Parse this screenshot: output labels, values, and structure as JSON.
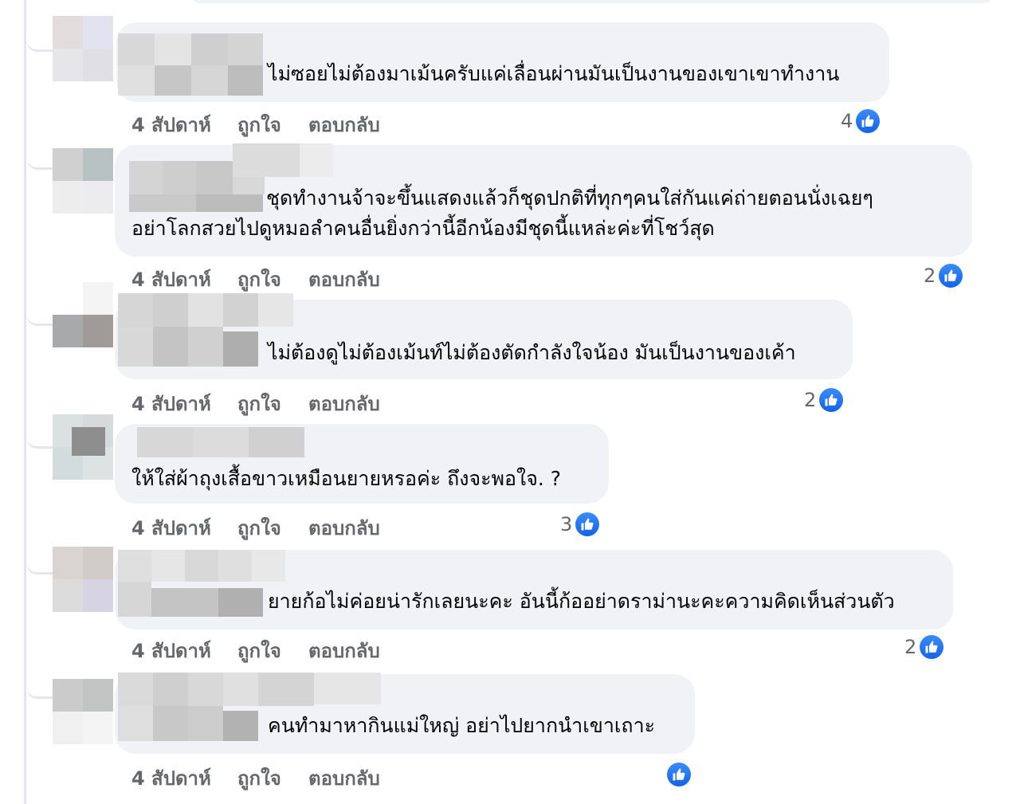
{
  "comments": [
    {
      "text_lines": [
        "ไม่ซอยไม่ต้องมาเม้นครับแค่เลื่อนผ่านมันเป็นงานของเขาเขาทำงาน"
      ],
      "time": "4 สัปดาห์",
      "like_label": "ถูกใจ",
      "reply_label": "ตอบกลับ",
      "reaction_count": "4"
    },
    {
      "text_lines": [
        "ชุดทำงานจ้าจะขึ้นแสดงแล้วก็ชุดปกติที่ทุกๆคนใส่กันแค่ถ่ายตอนนั่งเฉยๆ",
        "อย่าโลกสวยไปดูหมอลำคนอื่นยิ่งกว่านี้อีกน้องมีชุดนี้แหล่ะค่ะที่โชว์สุด"
      ],
      "time": "4 สัปดาห์",
      "like_label": "ถูกใจ",
      "reply_label": "ตอบกลับ",
      "reaction_count": "2"
    },
    {
      "text_lines": [
        "ไม่ต้องดูไม่ต้องเม้นท์ไม่ต้องตัดกำลังใจน้อง มันเป็นงานของเค้า"
      ],
      "time": "4 สัปดาห์",
      "like_label": "ถูกใจ",
      "reply_label": "ตอบกลับ",
      "reaction_count": "2"
    },
    {
      "text_lines": [
        "ให้ใส่ผ้าถุงเสื้อขาวเหมือนยายหรอค่ะ ถึงจะพอใจ. ?"
      ],
      "time": "4 สัปดาห์",
      "like_label": "ถูกใจ",
      "reply_label": "ตอบกลับ",
      "reaction_count": "3"
    },
    {
      "text_lines": [
        "ยายก้อไม่ค่อยน่ารักเลยนะคะ อันนี้ก้ออย่าดราม่านะคะความคิดเห็นส่วนตัว"
      ],
      "time": "4 สัปดาห์",
      "like_label": "ถูกใจ",
      "reply_label": "ตอบกลับ",
      "reaction_count": "2"
    },
    {
      "text_lines": [
        "คนทำมาหากินแม่ใหญ่ อย่าไปยากนำเขาเถาะ"
      ],
      "time": "4 สัปดาห์",
      "like_label": "ถูกใจ",
      "reply_label": "ตอบกลับ",
      "reaction_count": ""
    }
  ],
  "icons": {
    "reaction": "like-thumbs-up-icon"
  },
  "colors": {
    "bubble": "#f0f2f5",
    "meta_text": "#65676b",
    "like_blue": "#1877f2",
    "thread_line": "#e4e6eb"
  }
}
